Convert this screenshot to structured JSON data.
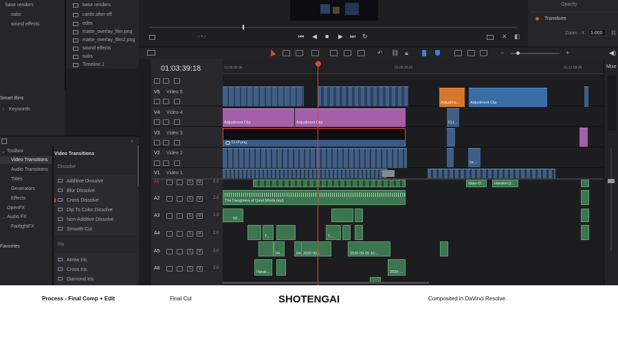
{
  "media_pool": {
    "items": [
      "base renders",
      "subs",
      "sound effects"
    ],
    "bin_items": [
      "base renders",
      "cards after eff",
      "edits",
      "matte_overlay_film.png",
      "matte_overlay_film2.png",
      "sound effects",
      "subs",
      "Timeline 1"
    ]
  },
  "smart_bins": {
    "title": "Smart Bins",
    "items": [
      "Keywords"
    ]
  },
  "effects": {
    "tree": [
      "Toolbox",
      "Video Transitions",
      "Audio Transitions",
      "Titles",
      "Generators",
      "Effects",
      "OpenFX",
      "Audio FX",
      "FairlightFX"
    ],
    "favorites": "Favorites",
    "section_title": "Video Transitions",
    "dissolve_header": "Dissolve",
    "dissolve_items": [
      "Additive Dissolve",
      "Blur Dissolve",
      "Cross Dissolve",
      "Dip To Color Dissolve",
      "Non-Additive Dissolve",
      "Smooth Cut"
    ],
    "iris_header": "Iris",
    "iris_items": [
      "Arrow Iris",
      "Cross Iris",
      "Diamond Iris"
    ]
  },
  "inspector": {
    "opacity_label": "Opacity",
    "transform_label": "Transform",
    "zoom_label": "Zoom",
    "zoom_axis": "X",
    "zoom_value": "1.000"
  },
  "timeline": {
    "timecode": "01:03:39:18",
    "ruler": [
      "01:00:00:00",
      "01:06:25:02",
      "01:12:58:00"
    ],
    "video_tracks": [
      {
        "id": "V5",
        "name": "Video 5"
      },
      {
        "id": "V4",
        "name": "Video 4"
      },
      {
        "id": "V3",
        "name": "Video 3"
      },
      {
        "id": "V2",
        "name": "Video 2"
      },
      {
        "id": "V1",
        "name": "Video 1"
      }
    ],
    "audio_tracks": [
      {
        "id": "A1",
        "level": "2.0"
      },
      {
        "id": "A2",
        "level": "2.0"
      },
      {
        "id": "A3",
        "level": "1.0"
      },
      {
        "id": "A4",
        "level": "2.0"
      },
      {
        "id": "A5",
        "level": "2.0"
      },
      {
        "id": "A6",
        "level": "2.0"
      }
    ],
    "clip_labels": {
      "adj1": "Adjustment Clip",
      "adj2": "Adjustment Clip",
      "adj3": "Adjustme...",
      "adj4": "Adjustment Clip",
      "clip_png": "CLIP.png",
      "cli": "CLI...",
      "ce": "ce...",
      "stars": "Stars O...",
      "harakiri": "Harakiri (1...",
      "daughters": "The Daughters of Quiet Minds.mp3",
      "a3_02": "02...",
      "a4_t1": "T...",
      "a4_t2": "T...",
      "a5_04a": "04...",
      "a5_04b": "04...",
      "a5_2020a": "2020-09...",
      "a5_2020b": "2020-09-05 16-...",
      "a6_harak": "Harak...",
      "a6_2020": "2020-..."
    },
    "mixer_label": "Mixe"
  },
  "footer": {
    "col1": "Process - Final Comp + Edit",
    "col2": "Final Cut",
    "col3": "SHOTENGAI",
    "col4": "Composited in DaVinci Resolve."
  },
  "colors": {
    "video_clip": "#3f5e86",
    "adjustment_clip": "#a45fa8",
    "orange_clip": "#d7772c",
    "audio_clip": "#3b7650",
    "playhead": "#e0453a"
  }
}
